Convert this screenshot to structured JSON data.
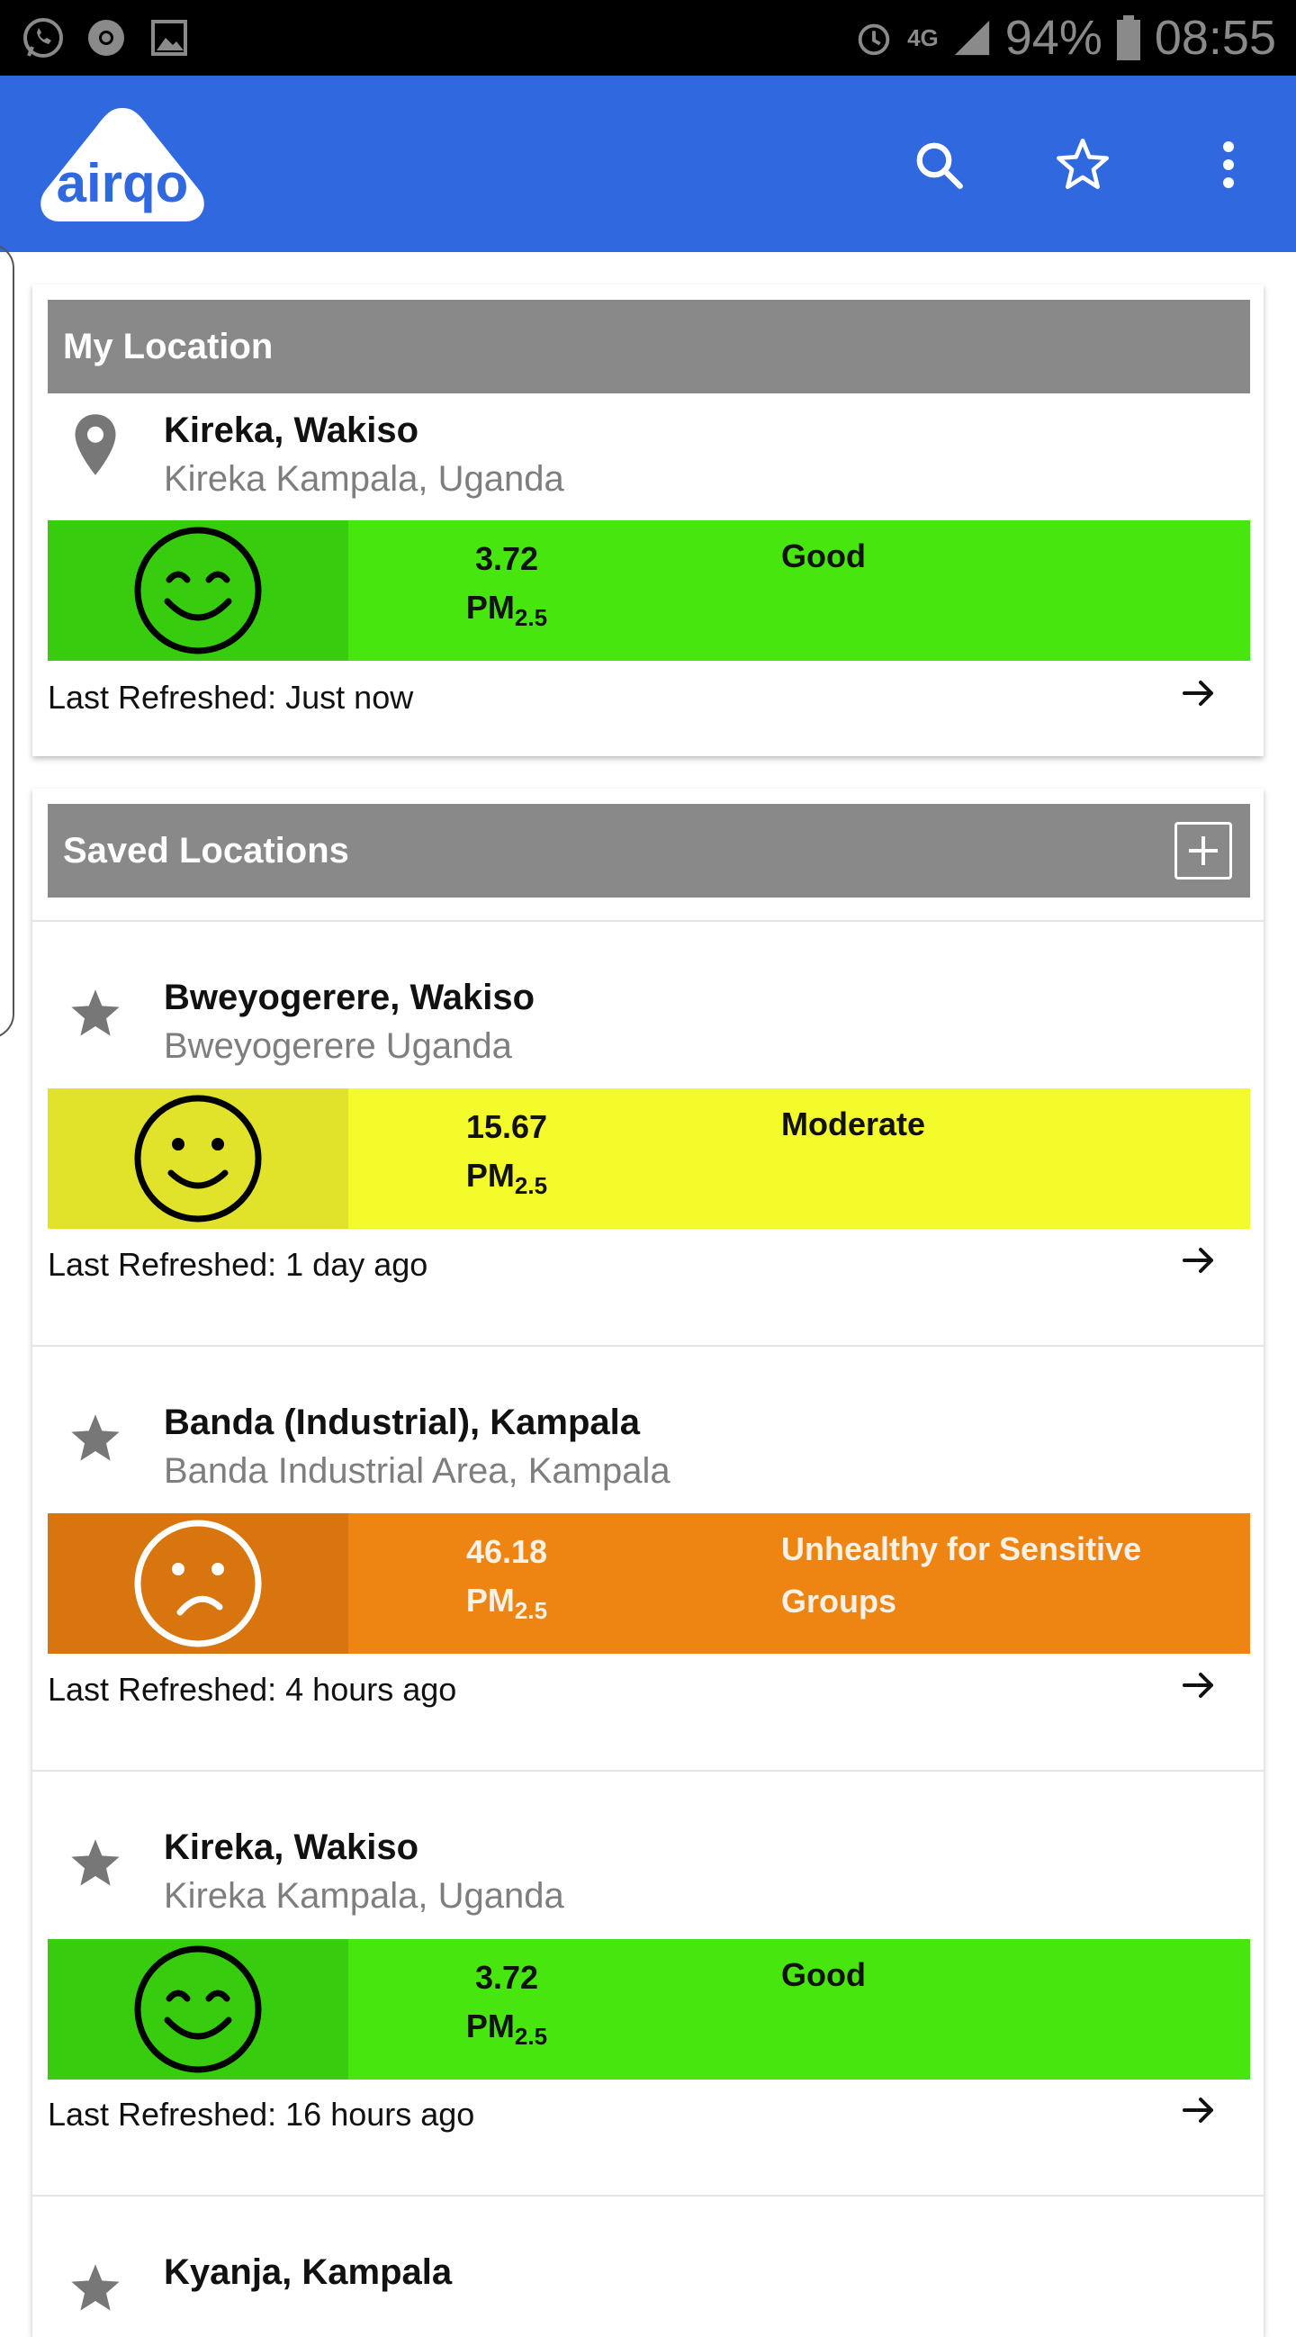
{
  "status_bar": {
    "battery": "94%",
    "time": "08:55",
    "network": "4G"
  },
  "app_bar": {
    "logo_text": "airqo",
    "icons": [
      "search-icon",
      "star-outline-icon",
      "more-vert-icon"
    ]
  },
  "my_location": {
    "header": "My Location",
    "title": "Kireka, Wakiso",
    "subtitle": "Kireka Kampala, Uganda",
    "value": "3.72",
    "unit": "PM",
    "unit_sub": "2.5",
    "category": "Good",
    "refreshed": "Last Refreshed: Just now"
  },
  "saved_locations": {
    "header": "Saved Locations",
    "items": [
      {
        "title": "Bweyogerere, Wakiso",
        "subtitle": "Bweyogerere Uganda",
        "value": "15.67",
        "unit": "PM",
        "unit_sub": "2.5",
        "category": "Moderate",
        "refreshed": "Last Refreshed: 1 day ago"
      },
      {
        "title": "Banda (Industrial), Kampala",
        "subtitle": "Banda Industrial Area, Kampala",
        "value": "46.18",
        "unit": "PM",
        "unit_sub": "2.5",
        "category": "Unhealthy for Sensitive Groups",
        "refreshed": "Last Refreshed: 4 hours ago"
      },
      {
        "title": "Kireka, Wakiso",
        "subtitle": "Kireka Kampala, Uganda",
        "value": "3.72",
        "unit": "PM",
        "unit_sub": "2.5",
        "category": "Good",
        "refreshed": "Last Refreshed: 16 hours ago"
      },
      {
        "title": "Kyanja, Kampala"
      }
    ]
  },
  "colors": {
    "app_bar": "#3068e0",
    "header_gray": "#898989",
    "good": "#46e60e",
    "good_face": "#38cc0e",
    "moderate": "#f4fb2a",
    "moderate_face": "#e1e22a",
    "usg": "#ee8412",
    "usg_face": "#d8750f"
  }
}
